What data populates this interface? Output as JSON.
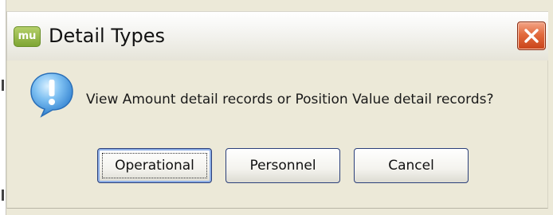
{
  "window": {
    "app_icon_text": "mu",
    "title": "Detail Types",
    "close_icon": "close-icon"
  },
  "dialog": {
    "icon": "info-balloon-icon",
    "message": "View Amount detail records or Position Value detail records?",
    "buttons": {
      "operational": "Operational",
      "personnel": "Personnel",
      "cancel": "Cancel"
    },
    "default_button": "Operational"
  },
  "colors": {
    "dialog_bg": "#ece9d8",
    "close_button": "#e26a3d",
    "button_border": "#2b3f7a",
    "info_icon": "#3f8fd6"
  }
}
